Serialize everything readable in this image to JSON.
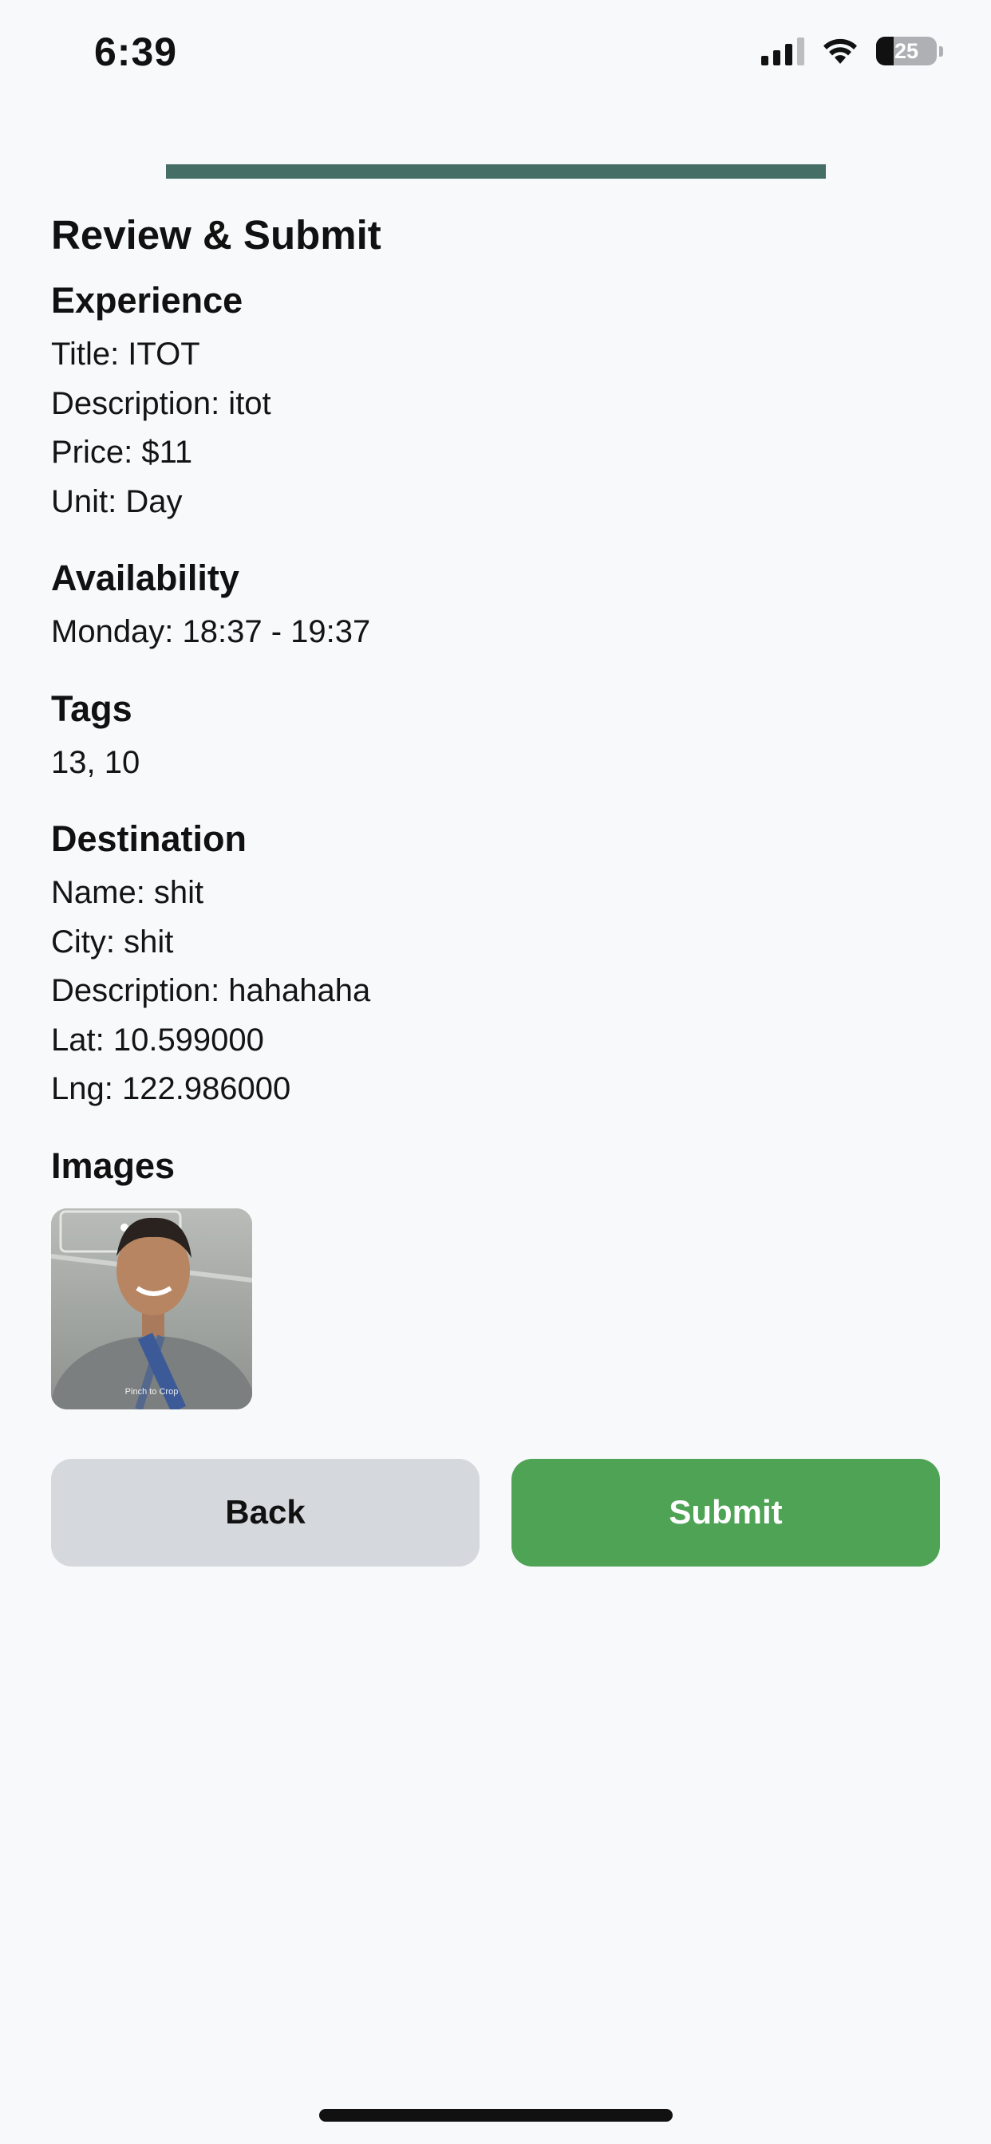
{
  "status_bar": {
    "time": "6:39",
    "battery_percent": "25",
    "icons": [
      "signal-icon",
      "wifi-icon",
      "battery-icon"
    ]
  },
  "progress": {
    "value": 1.0,
    "color": "#456f66"
  },
  "page": {
    "title": "Review & Submit"
  },
  "experience": {
    "heading": "Experience",
    "title": "Title: ITOT",
    "description": "Description: itot",
    "price": "Price: $11",
    "unit": "Unit: Day"
  },
  "availability": {
    "heading": "Availability",
    "slot": "Monday: 18:37 - 19:37"
  },
  "tags": {
    "heading": "Tags",
    "values": "13, 10"
  },
  "destination": {
    "heading": "Destination",
    "name": "Name: shit",
    "city": "City: shit",
    "description": "Description: hahahaha",
    "lat": "Lat: 10.599000",
    "lng": "Lng: 122.986000"
  },
  "images": {
    "heading": "Images",
    "items": [
      {
        "alt": "uploaded-photo",
        "overlay_text": "Pinch to Crop"
      }
    ]
  },
  "actions": {
    "back_label": "Back",
    "submit_label": "Submit",
    "back_color": "#d5d8dc",
    "submit_color": "#4ea354"
  }
}
